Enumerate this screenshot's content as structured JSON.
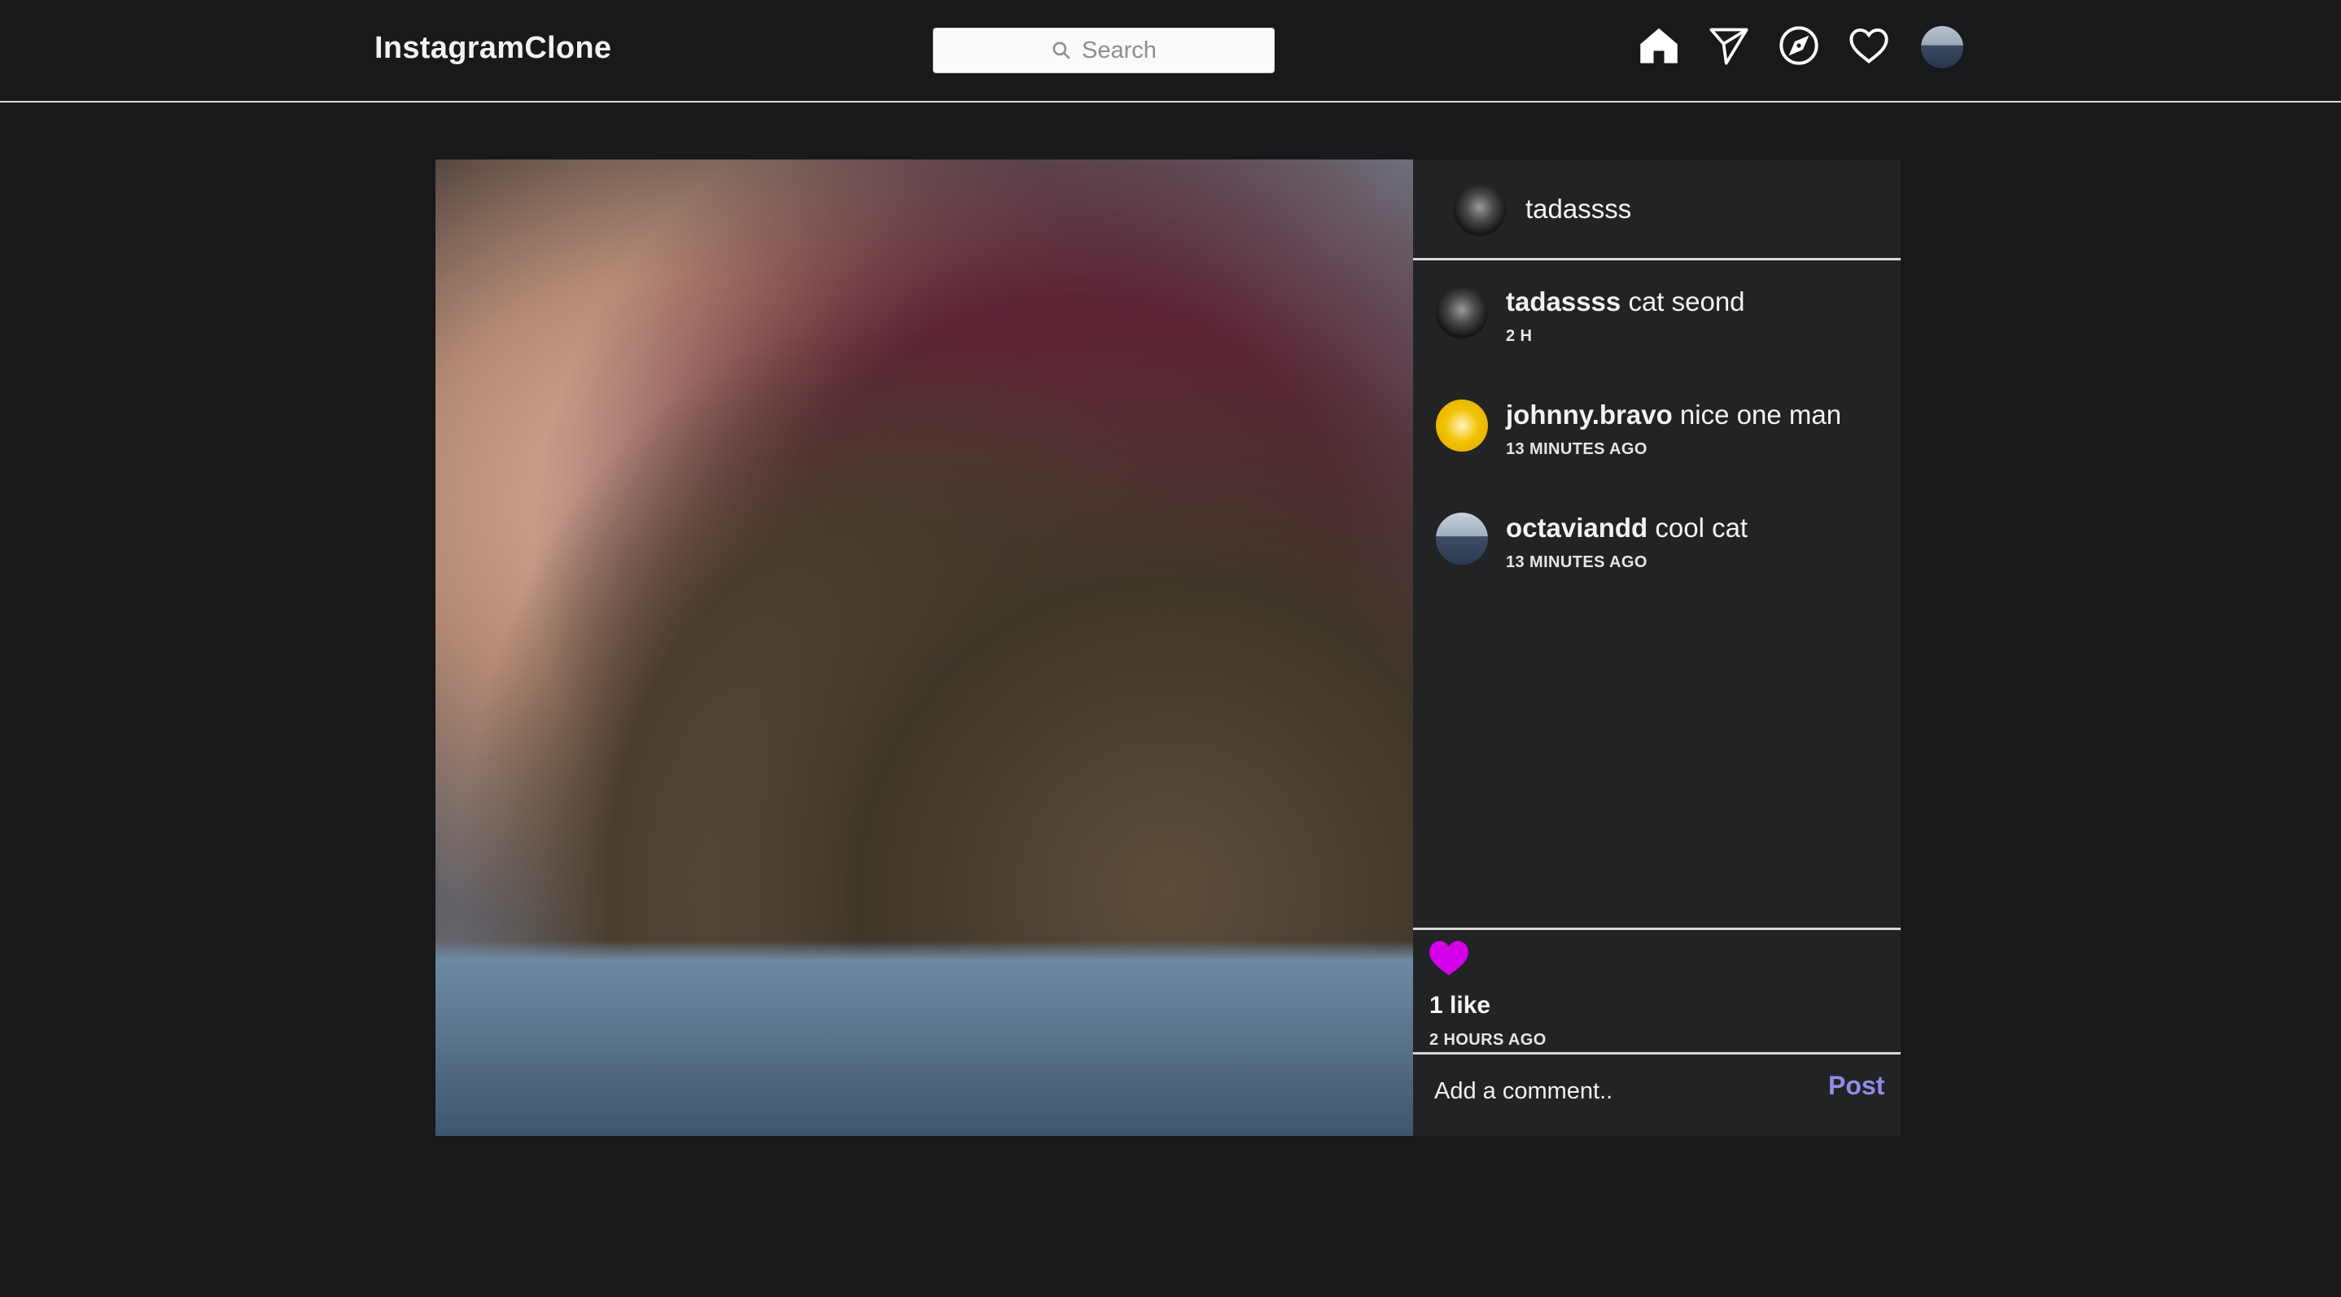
{
  "nav": {
    "brand": "InstagramClone",
    "search_placeholder": "Search",
    "icons": [
      "home-icon",
      "send-icon",
      "explore-icon",
      "heart-icon",
      "profile-avatar"
    ]
  },
  "post": {
    "author": "tadassss",
    "image_alt": "cat",
    "comments": [
      {
        "username": "tadassss",
        "text": "cat seond",
        "time": "2 H"
      },
      {
        "username": "johnny.bravo",
        "text": "nice one man",
        "time": "13 MINUTES AGO"
      },
      {
        "username": "octaviandd",
        "text": "cool cat",
        "time": "13 MINUTES AGO"
      }
    ],
    "liked": true,
    "like_color": "#d400e8",
    "likes_text": "1 like",
    "posted_time": "2 HOURS AGO",
    "comment_placeholder": "Add a comment..",
    "post_label": "Post",
    "post_label_color": "#8e8de8"
  }
}
